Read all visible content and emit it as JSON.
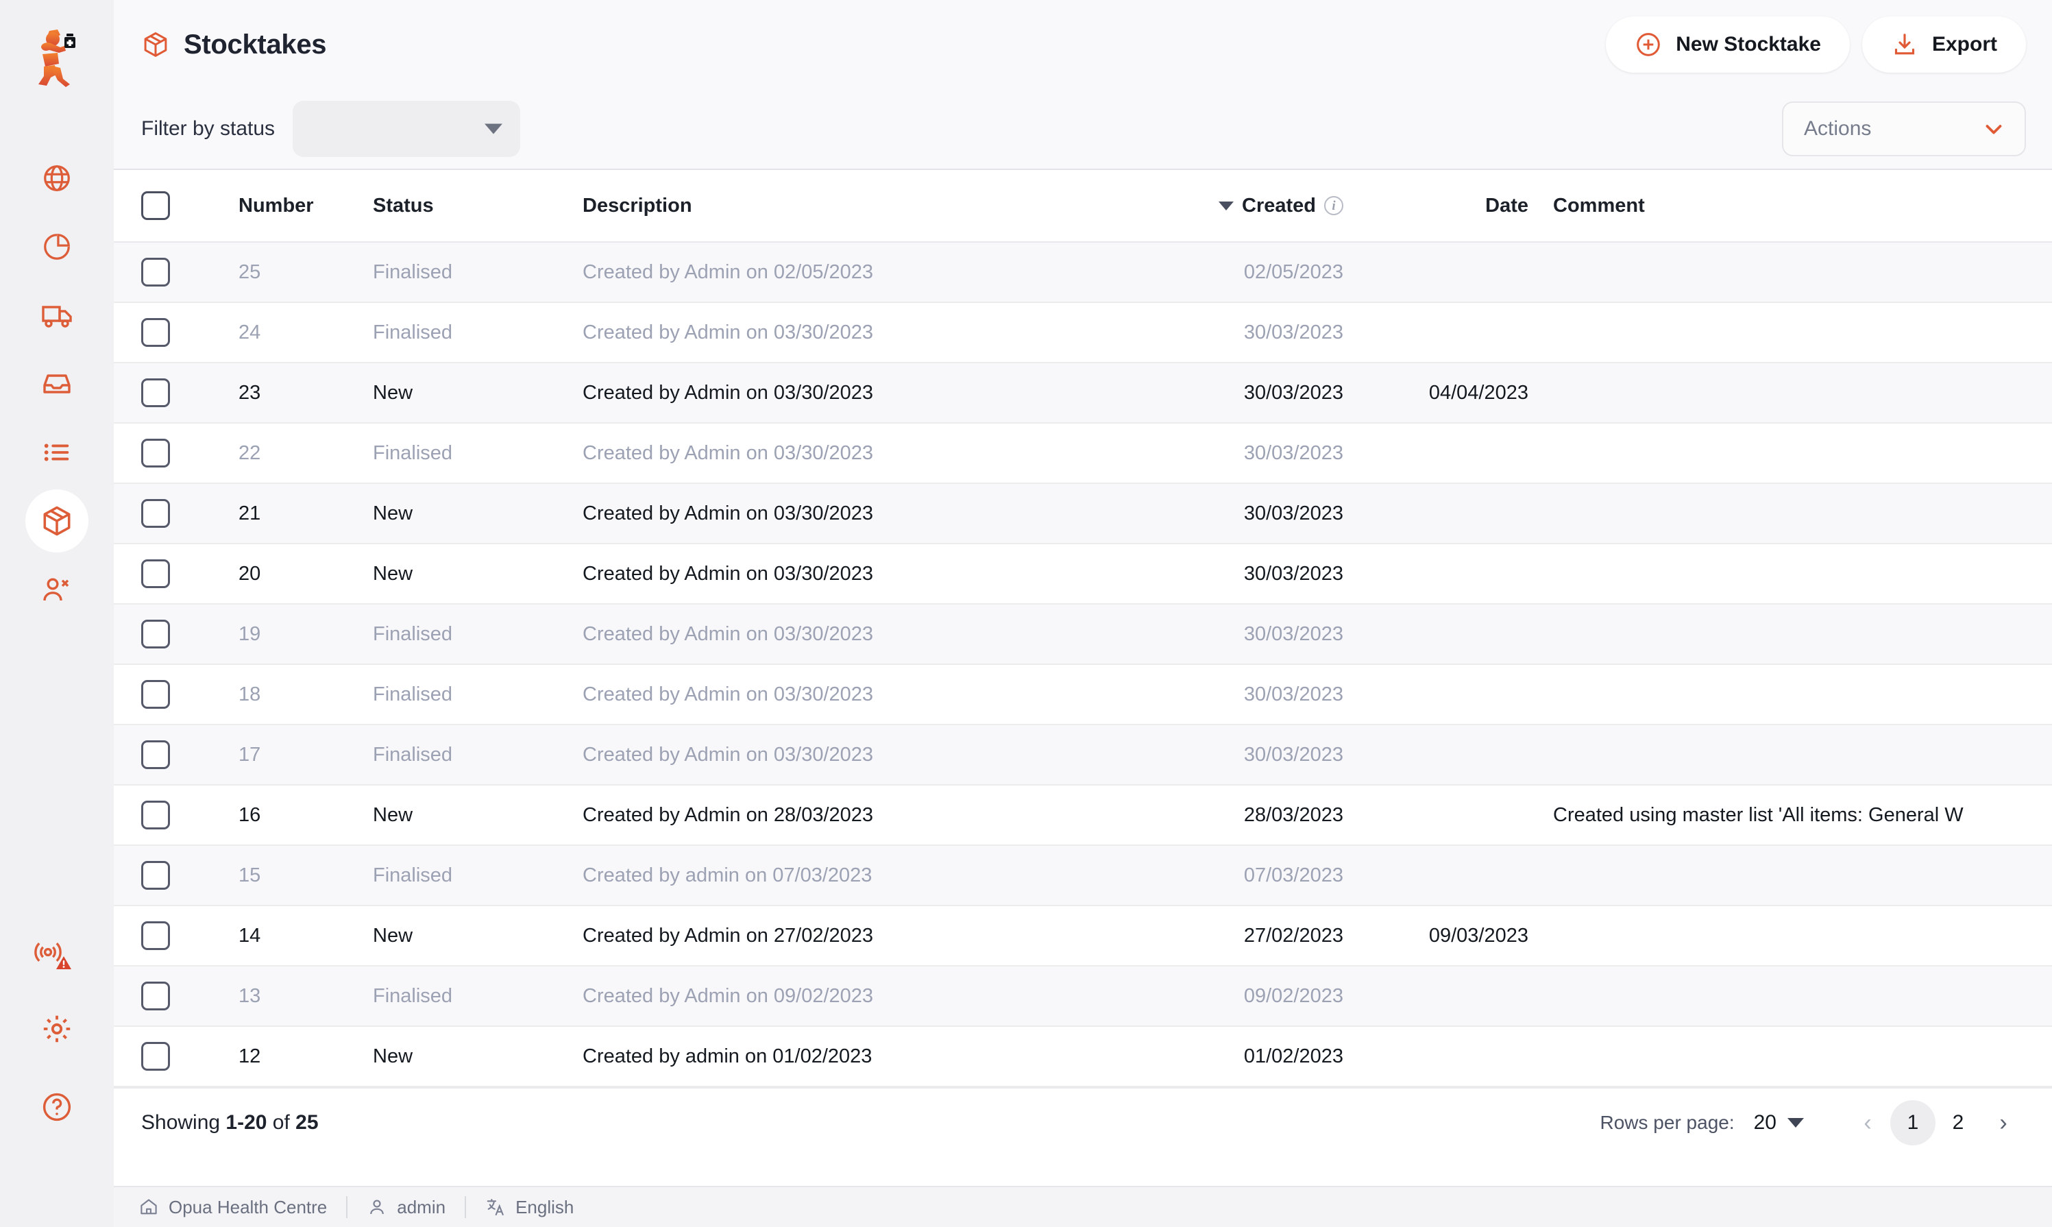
{
  "sidebar": {
    "logo_name": "mSupply running-man logo",
    "nav_items": [
      {
        "name": "globe",
        "label": "Dashboard"
      },
      {
        "name": "pie-chart",
        "label": "Reports"
      },
      {
        "name": "truck",
        "label": "Distribution"
      },
      {
        "name": "inbound-tray",
        "label": "Inbound Shipments"
      },
      {
        "name": "list",
        "label": "Requisitions"
      },
      {
        "name": "box",
        "label": "Stocktakes"
      },
      {
        "name": "people",
        "label": "Patients"
      }
    ],
    "active_index": 5,
    "bottom_items": [
      {
        "name": "sensor-alert",
        "label": "Cold Chain"
      },
      {
        "name": "gear",
        "label": "Settings"
      },
      {
        "name": "help",
        "label": "Help"
      }
    ]
  },
  "header": {
    "title": "Stocktakes",
    "title_icon": "box-icon",
    "new_button": {
      "label": "New Stocktake",
      "icon": "plus-circle-icon"
    },
    "export_button": {
      "label": "Export",
      "icon": "download-icon"
    }
  },
  "filters": {
    "status_label": "Filter by status",
    "status_value": "",
    "status_placeholder": "",
    "actions_placeholder": "Actions"
  },
  "table": {
    "columns": [
      {
        "key": "number",
        "label": "Number"
      },
      {
        "key": "status",
        "label": "Status"
      },
      {
        "key": "description",
        "label": "Description"
      },
      {
        "key": "created",
        "label": "Created",
        "sorted": true,
        "info": true
      },
      {
        "key": "date",
        "label": "Date"
      },
      {
        "key": "comment",
        "label": "Comment"
      }
    ],
    "rows": [
      {
        "number": "25",
        "status": "Finalised",
        "description": "Created by Admin on 02/05/2023",
        "created": "02/05/2023",
        "date": "",
        "comment": ""
      },
      {
        "number": "24",
        "status": "Finalised",
        "description": "Created by Admin on 03/30/2023",
        "created": "30/03/2023",
        "date": "",
        "comment": ""
      },
      {
        "number": "23",
        "status": "New",
        "description": "Created by Admin on 03/30/2023",
        "created": "30/03/2023",
        "date": "04/04/2023",
        "comment": ""
      },
      {
        "number": "22",
        "status": "Finalised",
        "description": "Created by Admin on 03/30/2023",
        "created": "30/03/2023",
        "date": "",
        "comment": ""
      },
      {
        "number": "21",
        "status": "New",
        "description": "Created by Admin on 03/30/2023",
        "created": "30/03/2023",
        "date": "",
        "comment": ""
      },
      {
        "number": "20",
        "status": "New",
        "description": "Created by Admin on 03/30/2023",
        "created": "30/03/2023",
        "date": "",
        "comment": ""
      },
      {
        "number": "19",
        "status": "Finalised",
        "description": "Created by Admin on 03/30/2023",
        "created": "30/03/2023",
        "date": "",
        "comment": ""
      },
      {
        "number": "18",
        "status": "Finalised",
        "description": "Created by Admin on 03/30/2023",
        "created": "30/03/2023",
        "date": "",
        "comment": ""
      },
      {
        "number": "17",
        "status": "Finalised",
        "description": "Created by Admin on 03/30/2023",
        "created": "30/03/2023",
        "date": "",
        "comment": ""
      },
      {
        "number": "16",
        "status": "New",
        "description": "Created by Admin on 28/03/2023",
        "created": "28/03/2023",
        "date": "",
        "comment": "Created using master list 'All items: General W"
      },
      {
        "number": "15",
        "status": "Finalised",
        "description": "Created by admin on 07/03/2023",
        "created": "07/03/2023",
        "date": "",
        "comment": ""
      },
      {
        "number": "14",
        "status": "New",
        "description": "Created by Admin on 27/02/2023",
        "created": "27/02/2023",
        "date": "09/03/2023",
        "comment": ""
      },
      {
        "number": "13",
        "status": "Finalised",
        "description": "Created by Admin on 09/02/2023",
        "created": "09/02/2023",
        "date": "",
        "comment": ""
      },
      {
        "number": "12",
        "status": "New",
        "description": "Created by admin on 01/02/2023",
        "created": "01/02/2023",
        "date": "",
        "comment": ""
      }
    ]
  },
  "footer": {
    "showing_prefix": "Showing ",
    "showing_range": "1-20",
    "showing_mid": " of ",
    "showing_total": "25",
    "rows_per_page_label": "Rows per page:",
    "rows_per_page_value": "20",
    "prev_label": "‹",
    "next_label": "›",
    "pages": [
      "1",
      "2"
    ],
    "active_page": "1"
  },
  "statusbar": {
    "store": "Opua Health Centre",
    "user": "admin",
    "language": "English"
  },
  "colors": {
    "accent": "#e05a36",
    "text": "#14181f",
    "muted": "#9ca1b3",
    "sidebar_bg": "#f1f1f4",
    "page_bg": "#f9f9fb"
  }
}
